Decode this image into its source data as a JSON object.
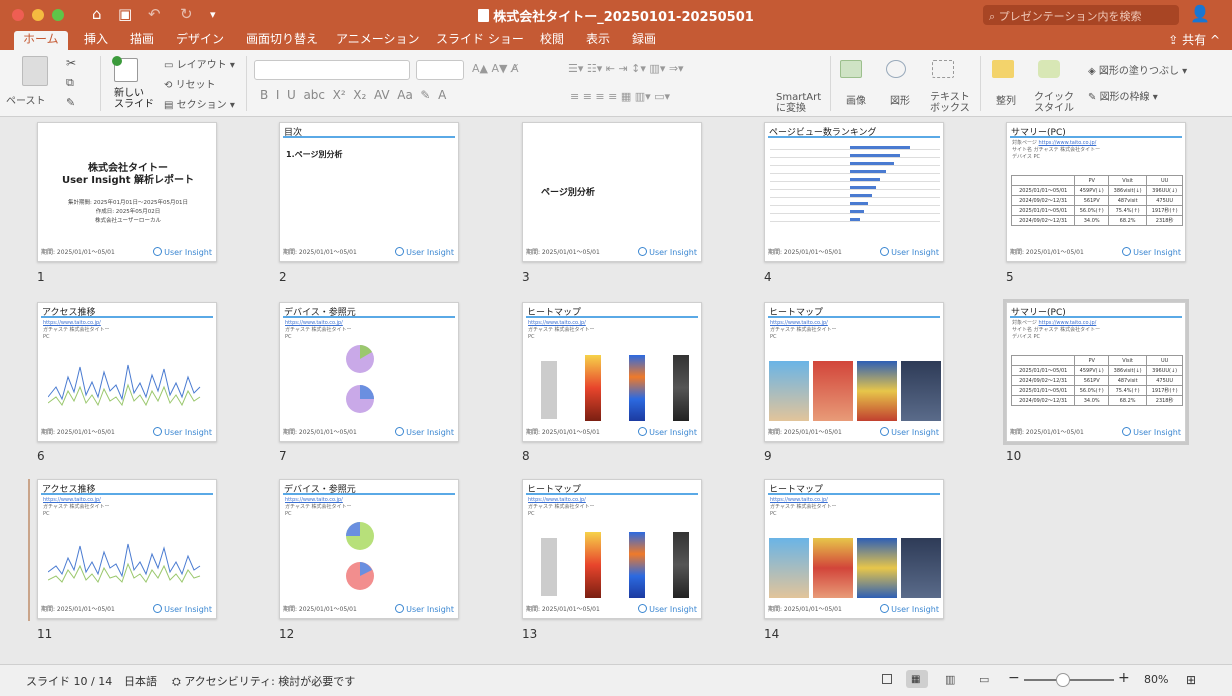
{
  "window": {
    "title": "株式会社タイトー_20250101-20250501",
    "search_placeholder": "プレゼンテーション内を検索"
  },
  "quick_access": [
    "home-icon",
    "save-icon",
    "undo-icon",
    "redo-icon",
    "customize-icon"
  ],
  "tabs": [
    {
      "label": "ホーム",
      "active": true
    },
    {
      "label": "挿入"
    },
    {
      "label": "描画"
    },
    {
      "label": "デザイン"
    },
    {
      "label": "画面切り替え"
    },
    {
      "label": "アニメーション"
    },
    {
      "label": "スライド ショー"
    },
    {
      "label": "校閲"
    },
    {
      "label": "表示"
    },
    {
      "label": "録画"
    }
  ],
  "share_label": "共有",
  "ribbon": {
    "paste": "ペースト",
    "new_slide": "新しい\nスライド",
    "layout": "レイアウト",
    "reset": "リセット",
    "section": "セクション",
    "smartart": "SmartArt\nに変換",
    "picture": "画像",
    "shapes": "図形",
    "textbox": "テキスト\nボックス",
    "arrange": "整列",
    "quick_styles": "クイック\nスタイル",
    "shape_fill": "図形の塗りつぶし",
    "shape_outline": "図形の枠線"
  },
  "slides": [
    {
      "num": "1",
      "type": "cover",
      "title": "株式会社タイトー\nUser Insight 解析レポート",
      "sub": "集計期間: 2025年01月01日〜2025年05月01日\n作成日: 2025年05月02日\n株式会社ユーザーローカル"
    },
    {
      "num": "2",
      "type": "toc",
      "header": "目次",
      "body": "1.ページ別分析"
    },
    {
      "num": "3",
      "type": "section",
      "body": "ページ別分析"
    },
    {
      "num": "4",
      "type": "ranking",
      "header": "ページビュー数ランキング"
    },
    {
      "num": "5",
      "type": "summary",
      "header": "サマリー(PC)"
    },
    {
      "num": "6",
      "type": "trend",
      "header": "アクセス推移"
    },
    {
      "num": "7",
      "type": "device",
      "header": "デバイス・参照元"
    },
    {
      "num": "8",
      "type": "heatmap",
      "header": "ヒートマップ"
    },
    {
      "num": "9",
      "type": "heatmap-img",
      "header": "ヒートマップ"
    },
    {
      "num": "10",
      "type": "summary",
      "header": "サマリー(PC)"
    },
    {
      "num": "11",
      "type": "trend",
      "header": "アクセス推移"
    },
    {
      "num": "12",
      "type": "device",
      "header": "デバイス・参照元"
    },
    {
      "num": "13",
      "type": "heatmap",
      "header": "ヒートマップ"
    },
    {
      "num": "14",
      "type": "heatmap-img",
      "header": "ヒートマップ"
    }
  ],
  "slide_common": {
    "footer_left": "期間: 2025/01/01〜05/01",
    "footer_brand": "User Insight",
    "meta_lines": [
      "対象ページ",
      "サイト名",
      "デバイス"
    ],
    "meta_values": [
      "https://www.taito.co.jp/",
      "ガチャステ 株式会社タイトー",
      "PC"
    ]
  },
  "summary_table": {
    "head": [
      "",
      "PV",
      "Visit",
      "UU"
    ],
    "rows": [
      [
        "2025/01/01〜05/01",
        "459PV(↓)",
        "386visit(↓)",
        "396UU(↓)"
      ],
      [
        "2024/09/02〜12/31",
        "561PV",
        "487visit",
        "475UU"
      ],
      [
        "2025/01/01〜05/01",
        "56.0%(↑)",
        "75.4%(↑)",
        "1917秒(↑)"
      ],
      [
        "2024/09/02〜12/31",
        "34.0%",
        "68.2%",
        "2318秒"
      ]
    ]
  },
  "status": {
    "slide_counter": "スライド 10 / 14",
    "language": "日本語",
    "accessibility": "アクセシビリティ: 検討が必要です",
    "zoom": "80%"
  }
}
